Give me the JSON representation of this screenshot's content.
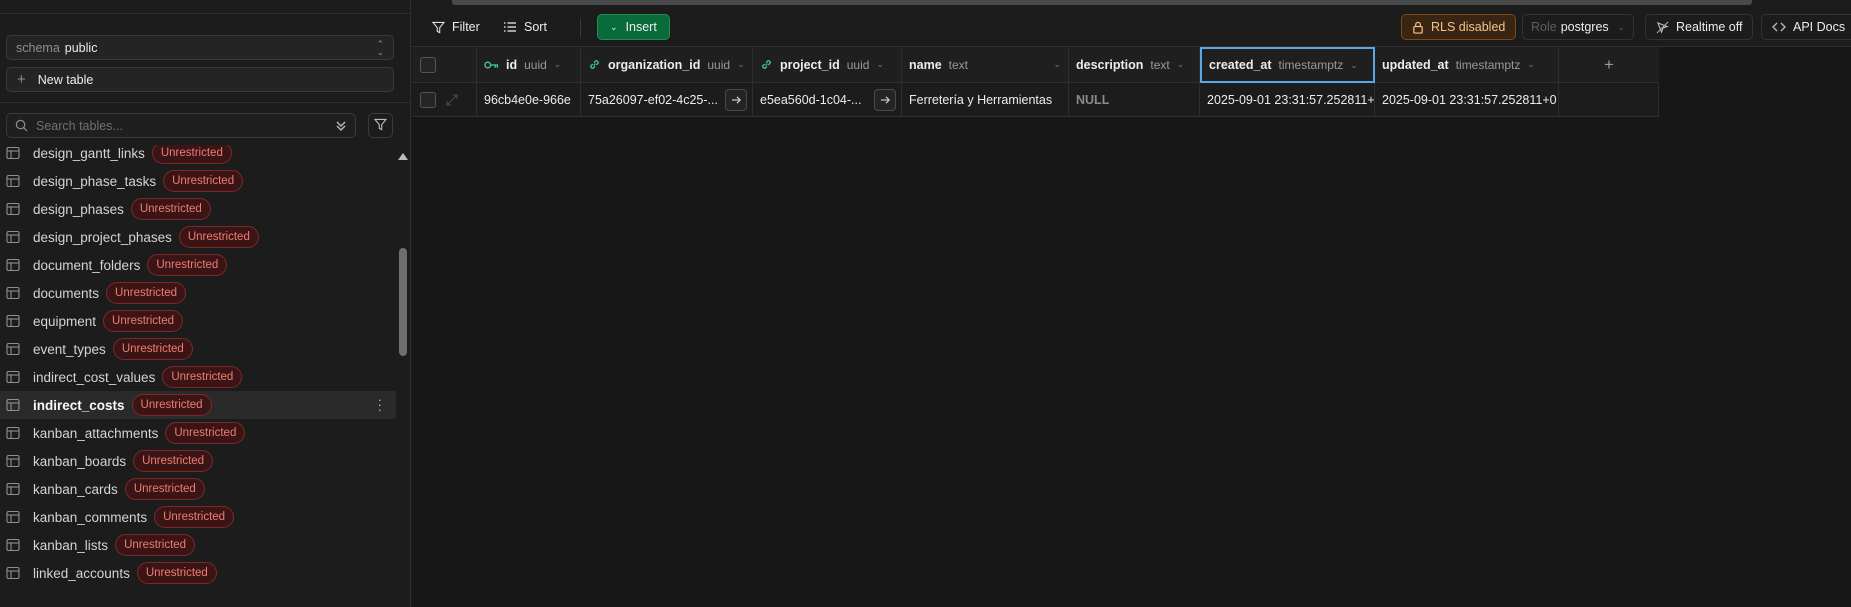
{
  "sidebar": {
    "schema_prefix": "schema",
    "schema_value": "public",
    "new_table_label": "New table",
    "search_placeholder": "Search tables...",
    "tables": [
      {
        "name": "design_gantt_links",
        "badge": "Unrestricted"
      },
      {
        "name": "design_phase_tasks",
        "badge": "Unrestricted"
      },
      {
        "name": "design_phases",
        "badge": "Unrestricted"
      },
      {
        "name": "design_project_phases",
        "badge": "Unrestricted"
      },
      {
        "name": "document_folders",
        "badge": "Unrestricted"
      },
      {
        "name": "documents",
        "badge": "Unrestricted"
      },
      {
        "name": "equipment",
        "badge": "Unrestricted"
      },
      {
        "name": "event_types",
        "badge": "Unrestricted"
      },
      {
        "name": "indirect_cost_values",
        "badge": "Unrestricted"
      },
      {
        "name": "indirect_costs",
        "badge": "Unrestricted",
        "active": true
      },
      {
        "name": "kanban_attachments",
        "badge": "Unrestricted"
      },
      {
        "name": "kanban_boards",
        "badge": "Unrestricted"
      },
      {
        "name": "kanban_cards",
        "badge": "Unrestricted"
      },
      {
        "name": "kanban_comments",
        "badge": "Unrestricted"
      },
      {
        "name": "kanban_lists",
        "badge": "Unrestricted"
      },
      {
        "name": "linked_accounts",
        "badge": "Unrestricted"
      }
    ]
  },
  "toolbar": {
    "filter_label": "Filter",
    "sort_label": "Sort",
    "insert_label": "Insert",
    "rls_label": "RLS disabled",
    "role_prefix": "Role",
    "role_value": "postgres",
    "realtime_label": "Realtime off",
    "api_docs_label": "API Docs"
  },
  "grid": {
    "columns": [
      {
        "name": "id",
        "type": "uuid",
        "icon": "key-icon"
      },
      {
        "name": "organization_id",
        "type": "uuid",
        "icon": "link-icon"
      },
      {
        "name": "project_id",
        "type": "uuid",
        "icon": "link-icon"
      },
      {
        "name": "name",
        "type": "text"
      },
      {
        "name": "description",
        "type": "text"
      },
      {
        "name": "created_at",
        "type": "timestamptz",
        "selected": true
      },
      {
        "name": "updated_at",
        "type": "timestamptz"
      }
    ],
    "rows": [
      {
        "id": "96cb4e0e-966e",
        "organization_id": "75a26097-ef02-4c25-...",
        "project_id": "e5ea560d-1c04-...",
        "name": "Ferretería y Herramientas",
        "description": "NULL",
        "created_at": "2025-09-01 23:31:57.252811+(",
        "updated_at": "2025-09-01 23:31:57.252811+0"
      }
    ]
  },
  "colors": {
    "accent_green": "#0a6b3a",
    "badge_red": "#f07b73",
    "rls_orange": "#f5c48a",
    "selected_blue": "#5aa7e6",
    "key_green": "#3ecf8e"
  }
}
